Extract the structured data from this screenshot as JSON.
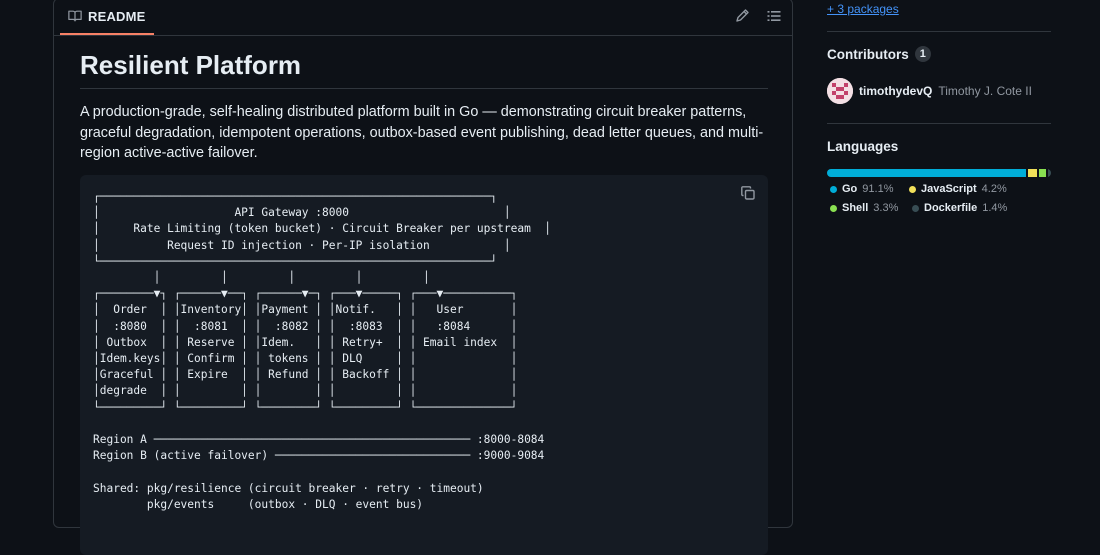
{
  "readme": {
    "tab_label": "README",
    "title": "Resilient Platform",
    "description": "A production-grade, self-healing distributed platform built in Go — demonstrating circuit breaker patterns, graceful degradation, idempotent operations, outbox-based event publishing, dead letter queues, and multi-region active-active failover.",
    "code": "┌──────────────────────────────────────────────────────────┐\n│                    API Gateway :8000                       │\n│     Rate Limiting (token bucket) · Circuit Breaker per upstream  │\n│          Request ID injection · Per-IP isolation           │\n└──────────────────────────────────────────────────────────┘\n         │         │         │         │         │\n┌────────▼┐ ┌──────▼──┐ ┌──────▼─┐ ┌───▼─────┐ ┌───▼──────────┐\n│  Order  │ │Inventory│ │Payment │ │Notif.   │ │   User       │\n│  :8080  │ │  :8081  │ │  :8082 │ │  :8083  │ │   :8084      │\n│ Outbox  │ │ Reserve │ │Idem.   │ │ Retry+  │ │ Email index  │\n│Idem.keys│ │ Confirm │ │ tokens │ │ DLQ     │ │              │\n│Graceful │ │ Expire  │ │ Refund │ │ Backoff │ │              │\n│degrade  │ │         │ │        │ │         │ │              │\n└─────────┘ └─────────┘ └────────┘ └─────────┘ └──────────────┘\n\nRegion A ─────────────────────────────────────────────── :8000-8084\nRegion B (active failover) ───────────────────────────── :9000-9084\n\nShared: pkg/resilience (circuit breaker · retry · timeout)\n        pkg/events     (outbox · DLQ · event bus)"
  },
  "sidebar": {
    "packages_link": "+ 3 packages",
    "contributors": {
      "title": "Contributors",
      "count": "1",
      "items": [
        {
          "login": "timothydevQ",
          "name": "Timothy J. Cote II"
        }
      ]
    },
    "languages": {
      "title": "Languages",
      "items": [
        {
          "name": "Go",
          "percent": "91.1%",
          "value": 91.1,
          "color": "#00add8"
        },
        {
          "name": "JavaScript",
          "percent": "4.2%",
          "value": 4.2,
          "color": "#f1e05a"
        },
        {
          "name": "Shell",
          "percent": "3.3%",
          "value": 3.3,
          "color": "#89e051"
        },
        {
          "name": "Dockerfile",
          "percent": "1.4%",
          "value": 1.4,
          "color": "#384d54"
        }
      ]
    }
  },
  "icons": {
    "readme": "book-icon",
    "edit": "pencil-icon",
    "outline": "list-icon",
    "copy": "copy-icon"
  }
}
